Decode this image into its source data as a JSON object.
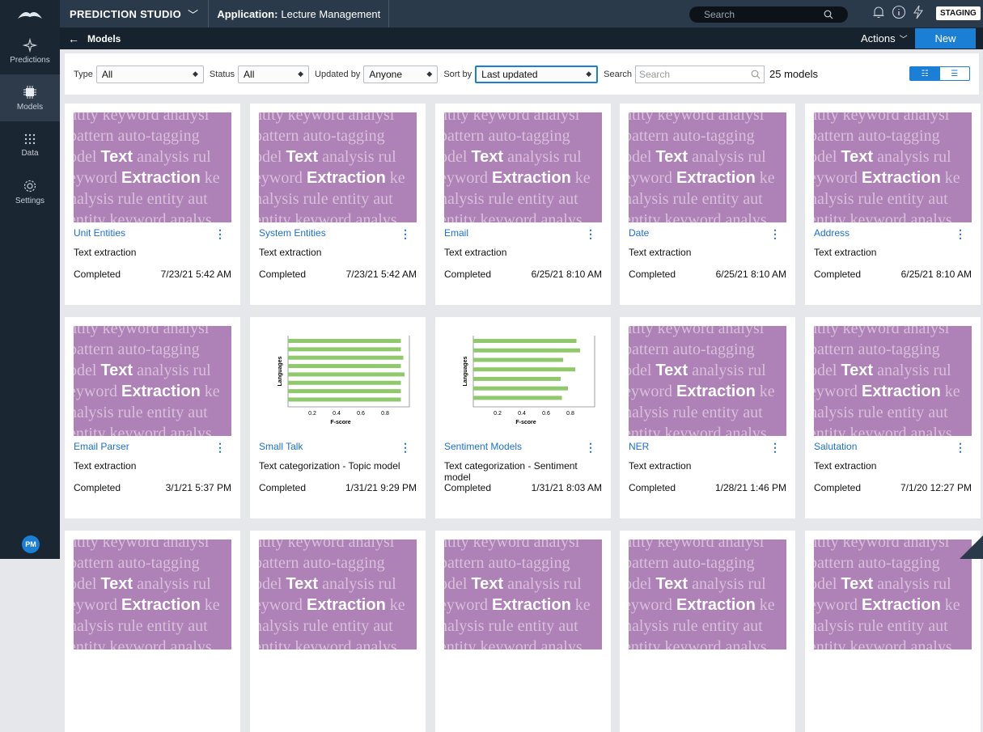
{
  "sidebar": {
    "items": [
      {
        "label": "Predictions",
        "icon": "sparkle-icon"
      },
      {
        "label": "Models",
        "icon": "chip-icon"
      },
      {
        "label": "Data",
        "icon": "grid-icon"
      },
      {
        "label": "Settings",
        "icon": "gear-icon"
      }
    ],
    "avatar": "PM"
  },
  "topbar": {
    "studio": "PREDICTION STUDIO",
    "app_label": "Application:",
    "app_name": "Lecture Management",
    "search_placeholder": "Search",
    "env": "STAGING"
  },
  "subbar": {
    "title": "Models",
    "actions": "Actions",
    "new": "New"
  },
  "filters": {
    "type_label": "Type",
    "type_value": "All",
    "status_label": "Status",
    "status_value": "All",
    "updated_label": "Updated by",
    "updated_value": "Anyone",
    "sort_label": "Sort by",
    "sort_value": "Last updated",
    "search_label": "Search",
    "search_placeholder": "Search",
    "count": "25 models"
  },
  "thumb_text": {
    "l1": "ntity keyword analysi",
    "l2a": "pattern auto-tagging",
    "l3a": "odel ",
    "l3w": "Text",
    "l3b": " analysis rul",
    "l4a": "eyword ",
    "l4w": "Extraction",
    "l4b": " ke",
    "l5": "nalysis rule entity aut",
    "l6": "entity keyword analys"
  },
  "chart_thumb": {
    "ylabel": "Languages",
    "xlabel": "F-score",
    "ticks": [
      "0.2",
      "0.4",
      "0.6",
      "0.8"
    ]
  },
  "chart_data": [
    {
      "type": "bar",
      "orientation": "horizontal",
      "title": "",
      "xlabel": "F-score",
      "ylabel": "Languages",
      "xlim": [
        0,
        1
      ],
      "values": [
        0.93,
        0.93,
        0.95,
        0.93,
        0.96,
        0.93,
        0.93,
        0.93
      ],
      "color": "#8fc96b"
    },
    {
      "type": "bar",
      "orientation": "horizontal",
      "title": "",
      "xlabel": "F-score",
      "ylabel": "Languages",
      "xlim": [
        0,
        1
      ],
      "values": [
        0.85,
        0.88,
        0.74,
        0.84,
        0.72,
        0.78,
        0.73
      ],
      "color": "#8fc96b"
    }
  ],
  "models": [
    {
      "title": "Unit Entities",
      "type": "Text extraction",
      "status": "Completed",
      "date": "7/23/21 5:42 AM",
      "thumb": "text"
    },
    {
      "title": "System Entities",
      "type": "Text extraction",
      "status": "Completed",
      "date": "7/23/21 5:42 AM",
      "thumb": "text"
    },
    {
      "title": "Email",
      "type": "Text extraction",
      "status": "Completed",
      "date": "6/25/21 8:10 AM",
      "thumb": "text"
    },
    {
      "title": "Date",
      "type": "Text extraction",
      "status": "Completed",
      "date": "6/25/21 8:10 AM",
      "thumb": "text"
    },
    {
      "title": "Address",
      "type": "Text extraction",
      "status": "Completed",
      "date": "6/25/21 8:10 AM",
      "thumb": "text"
    },
    {
      "title": "Email Parser",
      "type": "Text extraction",
      "status": "Completed",
      "date": "3/1/21 5:37 PM",
      "thumb": "text"
    },
    {
      "title": "Small Talk",
      "type": "Text categorization - Topic model",
      "status": "Completed",
      "date": "1/31/21 9:29 PM",
      "thumb": "chart0"
    },
    {
      "title": "Sentiment Models",
      "type": "Text categorization - Sentiment model",
      "status": "Completed",
      "date": "1/31/21 8:03 AM",
      "thumb": "chart1"
    },
    {
      "title": "NER",
      "type": "Text extraction",
      "status": "Completed",
      "date": "1/28/21 1:46 PM",
      "thumb": "text"
    },
    {
      "title": "Salutation",
      "type": "Text extraction",
      "status": "Completed",
      "date": "7/1/20 12:27 PM",
      "thumb": "text"
    },
    {
      "title": "",
      "type": "",
      "status": "",
      "date": "",
      "thumb": "text"
    },
    {
      "title": "",
      "type": "",
      "status": "",
      "date": "",
      "thumb": "text"
    },
    {
      "title": "",
      "type": "",
      "status": "",
      "date": "",
      "thumb": "text"
    },
    {
      "title": "",
      "type": "",
      "status": "",
      "date": "",
      "thumb": "text"
    },
    {
      "title": "",
      "type": "",
      "status": "",
      "date": "",
      "thumb": "text"
    }
  ]
}
